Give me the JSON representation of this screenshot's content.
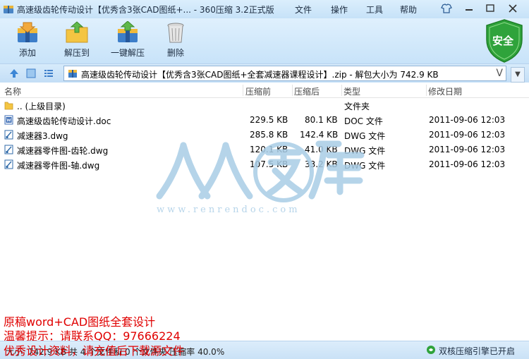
{
  "window": {
    "title": "高速级齿轮传动设计【优秀含3张CAD图纸+... - 360压缩 3.2正式版",
    "menu": [
      "文件",
      "操作",
      "工具",
      "帮助"
    ]
  },
  "toolbar": {
    "items": [
      {
        "label": "添加",
        "icon": "add-archive-icon"
      },
      {
        "label": "解压到",
        "icon": "extract-to-icon"
      },
      {
        "label": "一键解压",
        "icon": "one-click-extract-icon"
      },
      {
        "label": "删除",
        "icon": "trash-icon"
      }
    ],
    "security_label": "安全"
  },
  "address": {
    "path": "高速级齿轮传动设计【优秀含3张CAD图纸+全套减速器课程设计】.zip - 解包大小为 742.9 KB",
    "v_glyph": "V"
  },
  "columns": [
    "名称",
    "压缩前",
    "压缩后",
    "类型",
    "修改日期"
  ],
  "files": [
    {
      "name": ".. (上级目录)",
      "size": "",
      "packed": "",
      "type": "文件夹",
      "modified": "",
      "icon": "folder-icon"
    },
    {
      "name": "高速级齿轮传动设计.doc",
      "size": "229.5 KB",
      "packed": "80.1 KB",
      "type": "DOC 文件",
      "modified": "2011-09-06 12:03",
      "icon": "doc-file-icon"
    },
    {
      "name": "减速器3.dwg",
      "size": "285.8 KB",
      "packed": "142.4 KB",
      "type": "DWG 文件",
      "modified": "2011-09-06 12:03",
      "icon": "dwg-file-icon"
    },
    {
      "name": "减速器零件图-齿轮.dwg",
      "size": "120.1 KB",
      "packed": "41.0 KB",
      "type": "DWG 文件",
      "modified": "2011-09-06 12:03",
      "icon": "dwg-file-icon"
    },
    {
      "name": "减速器零件图-轴.dwg",
      "size": "107.5 KB",
      "packed": "33.2 KB",
      "type": "DWG 文件",
      "modified": "2011-09-06 12:03",
      "icon": "dwg-file-icon"
    }
  ],
  "watermark": {
    "url": "www.renrendoc.com"
  },
  "notes": [
    "原稿word+CAD图纸全套设计",
    "温馨提示：请联系QQ：97666224",
    "优秀设计资料，请充值后下载源文件"
  ],
  "status": {
    "text": "大小: 742.9 KB 共 4 个文件和 0 个文件夹 压缩率 40.0%",
    "engine": "双核压缩引擎已开启"
  },
  "colors": {
    "note_red": "#e00000",
    "shield_green": "#2fa33b",
    "watermark_blue": "#b7d5ea"
  }
}
